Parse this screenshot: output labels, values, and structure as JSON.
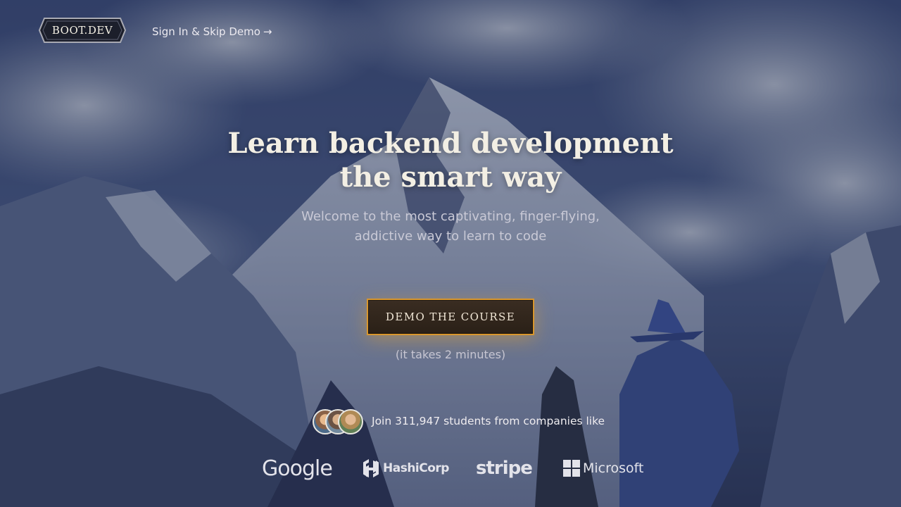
{
  "header": {
    "logo_text": "BOOT.DEV",
    "signin_label": "Sign In & Skip Demo",
    "signin_arrow": "→"
  },
  "hero": {
    "headline": "Learn backend development the smart way",
    "subline": "Welcome to the most captivating, finger-flying, addictive way to learn to code"
  },
  "cta": {
    "label": "DEMO THE COURSE",
    "note": "(it takes 2 minutes)"
  },
  "social_proof": {
    "text": "Join 311,947 students from companies like"
  },
  "companies": [
    "Google",
    "HashiCorp",
    "stripe",
    "Microsoft"
  ],
  "colors": {
    "accent": "#d9962c",
    "cta_bg": "#2f241b",
    "background": "#2b3556"
  },
  "icons": [
    "arrow-right-icon",
    "hashicorp-logo-icon",
    "microsoft-logo-icon"
  ]
}
